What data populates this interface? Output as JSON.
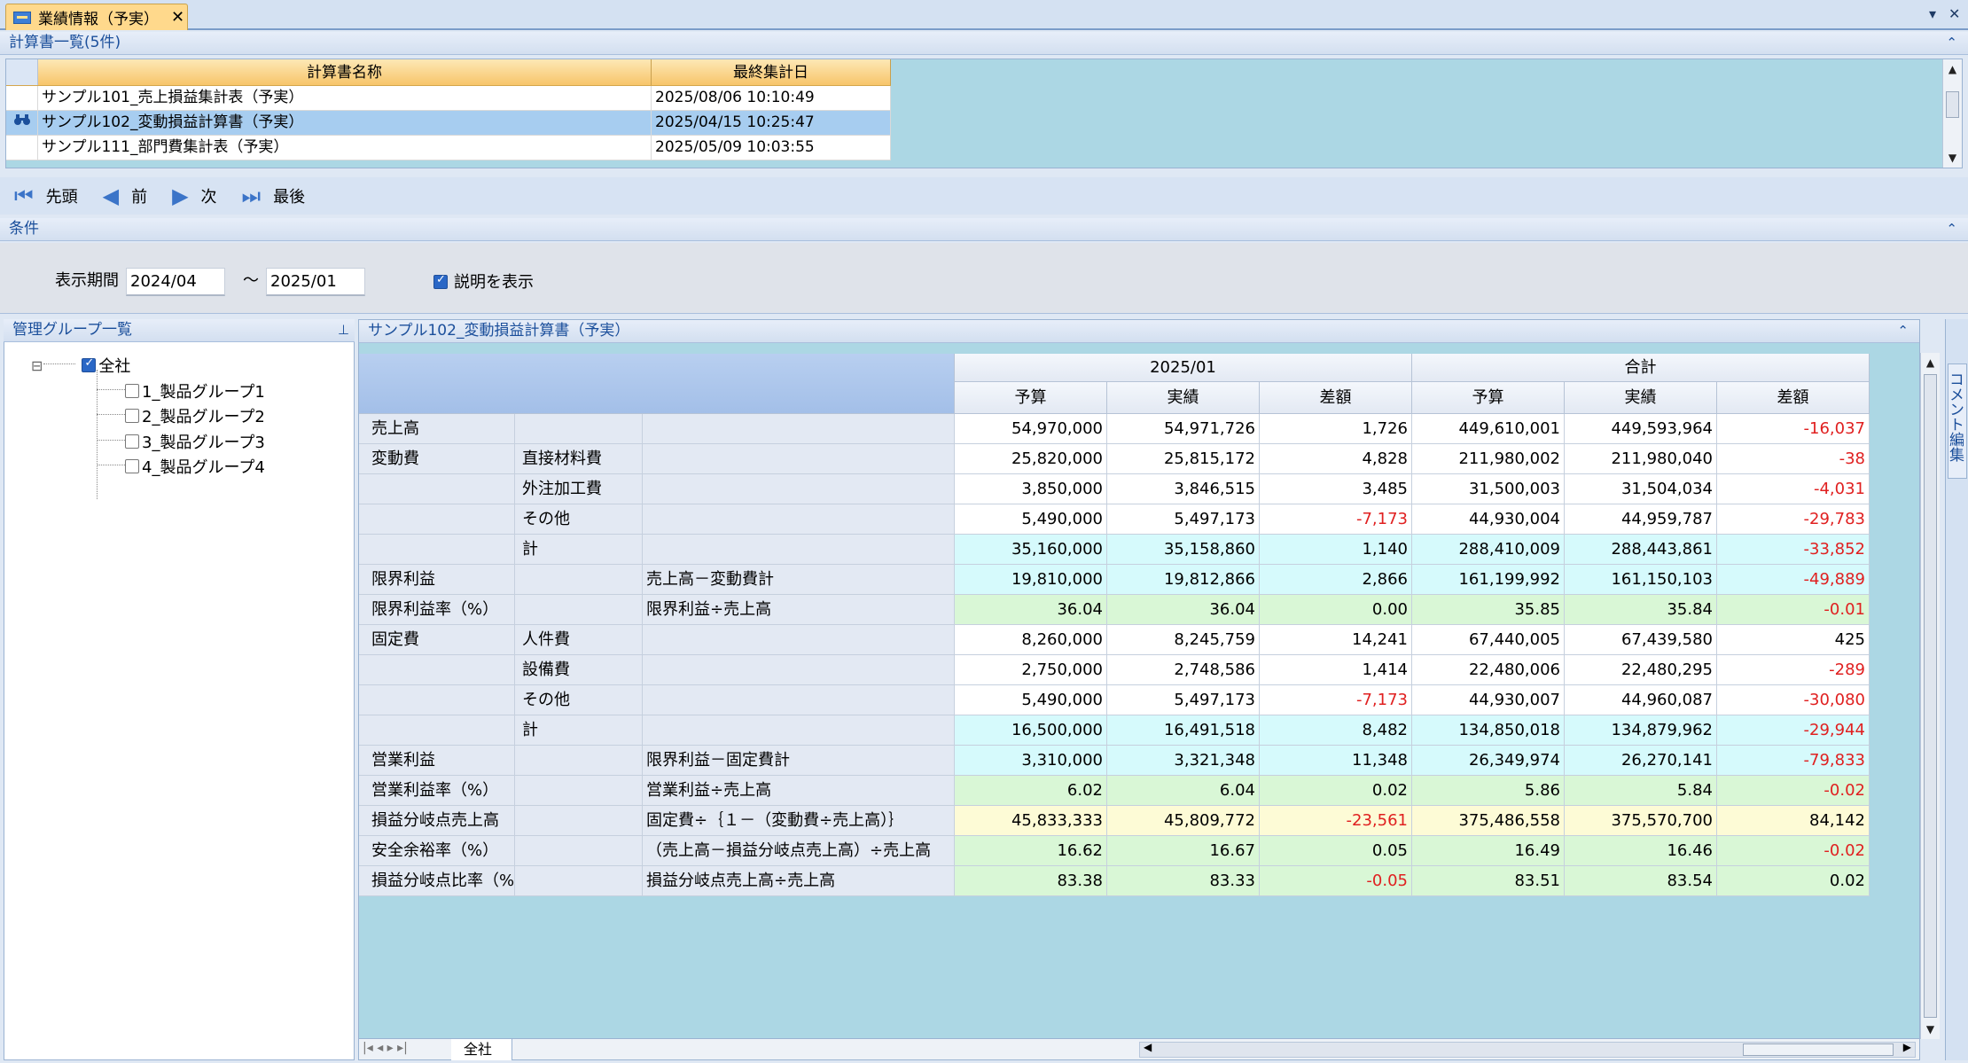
{
  "document_tab": {
    "title": "業績情報（予実）",
    "close": "✕"
  },
  "window_controls": {
    "dropdown": "▾",
    "close": "✕"
  },
  "list_panel": {
    "title": "計算書一覧(5件)",
    "columns": [
      "計算書名称",
      "最終集計日"
    ],
    "rows": [
      {
        "name": "サンプル101_売上損益集計表（予実）",
        "date": "2025/08/06 10:10:49"
      },
      {
        "name": "サンプル102_変動損益計算書（予実）",
        "date": "2025/04/15 10:25:47"
      },
      {
        "name": "サンプル111_部門費集計表（予実）",
        "date": "2025/05/09 10:03:55"
      }
    ]
  },
  "navigator": {
    "first": "先頭",
    "prev": "前",
    "next": "次",
    "last": "最後"
  },
  "condition_panel": {
    "title": "条件",
    "period_label": "表示期間",
    "period_from": "2024/04",
    "tilde": "～",
    "period_to": "2025/01",
    "show_description_label": "説明を表示",
    "show_description_checked": true
  },
  "tree_panel": {
    "title": "管理グループ一覧",
    "pin": "ᵖ",
    "root": {
      "label": "全社",
      "checked": true,
      "expander": "⊟"
    },
    "children": [
      "1_製品グループ1",
      "2_製品グループ2",
      "3_製品グループ3",
      "4_製品グループ4"
    ]
  },
  "report_panel": {
    "title": "サンプル102_変動損益計算書（予実）",
    "groups": [
      "2025/01",
      "合計"
    ],
    "subcols": [
      "予算",
      "実績",
      "差額",
      "予算",
      "実績",
      "差額"
    ],
    "rows": [
      {
        "c1": "売上高",
        "c2": "",
        "c3": "",
        "vals": [
          "54,970,000",
          "54,971,726",
          "1,726",
          "449,610,001",
          "449,593,964",
          "-16,037"
        ]
      },
      {
        "c1": "変動費",
        "c2": "直接材料費",
        "c3": "",
        "vals": [
          "25,820,000",
          "25,815,172",
          "4,828",
          "211,980,002",
          "211,980,040",
          "-38"
        ]
      },
      {
        "c1": "",
        "c2": "外注加工費",
        "c3": "",
        "vals": [
          "3,850,000",
          "3,846,515",
          "3,485",
          "31,500,003",
          "31,504,034",
          "-4,031"
        ]
      },
      {
        "c1": "",
        "c2": "その他",
        "c3": "",
        "vals": [
          "5,490,000",
          "5,497,173",
          "-7,173",
          "44,930,004",
          "44,959,787",
          "-29,783"
        ]
      },
      {
        "c1": "",
        "c2": "計",
        "c3": "",
        "vals": [
          "35,160,000",
          "35,158,860",
          "1,140",
          "288,410,009",
          "288,443,861",
          "-33,852"
        ]
      },
      {
        "c1": "限界利益",
        "c2": "",
        "c3": "売上高－変動費計",
        "vals": [
          "19,810,000",
          "19,812,866",
          "2,866",
          "161,199,992",
          "161,150,103",
          "-49,889"
        ]
      },
      {
        "c1": "限界利益率（%）",
        "c2": "",
        "c3": "限界利益÷売上高",
        "vals": [
          "36.04",
          "36.04",
          "0.00",
          "35.85",
          "35.84",
          "-0.01"
        ]
      },
      {
        "c1": "固定費",
        "c2": "人件費",
        "c3": "",
        "vals": [
          "8,260,000",
          "8,245,759",
          "14,241",
          "67,440,005",
          "67,439,580",
          "425"
        ]
      },
      {
        "c1": "",
        "c2": "設備費",
        "c3": "",
        "vals": [
          "2,750,000",
          "2,748,586",
          "1,414",
          "22,480,006",
          "22,480,295",
          "-289"
        ]
      },
      {
        "c1": "",
        "c2": "その他",
        "c3": "",
        "vals": [
          "5,490,000",
          "5,497,173",
          "-7,173",
          "44,930,007",
          "44,960,087",
          "-30,080"
        ]
      },
      {
        "c1": "",
        "c2": "計",
        "c3": "",
        "vals": [
          "16,500,000",
          "16,491,518",
          "8,482",
          "134,850,018",
          "134,879,962",
          "-29,944"
        ]
      },
      {
        "c1": "営業利益",
        "c2": "",
        "c3": "限界利益－固定費計",
        "vals": [
          "3,310,000",
          "3,321,348",
          "11,348",
          "26,349,974",
          "26,270,141",
          "-79,833"
        ]
      },
      {
        "c1": "営業利益率（%）",
        "c2": "",
        "c3": "営業利益÷売上高",
        "vals": [
          "6.02",
          "6.04",
          "0.02",
          "5.86",
          "5.84",
          "-0.02"
        ]
      },
      {
        "c1": "損益分岐点売上高",
        "c2": "",
        "c3": "固定費÷｛１－（変動費÷売上高）｝",
        "vals": [
          "45,833,333",
          "45,809,772",
          "-23,561",
          "375,486,558",
          "375,570,700",
          "84,142"
        ]
      },
      {
        "c1": "安全余裕率（%）",
        "c2": "",
        "c3": "（売上高－損益分岐点売上高）÷売上高",
        "vals": [
          "16.62",
          "16.67",
          "0.05",
          "16.49",
          "16.46",
          "-0.02"
        ]
      },
      {
        "c1": "損益分岐点比率（%）",
        "c2": "",
        "c3": "損益分岐点売上高÷売上高",
        "vals": [
          "83.38",
          "83.33",
          "-0.05",
          "83.51",
          "83.54",
          "0.02"
        ]
      }
    ],
    "row_colors": [
      "#ffffff",
      "#ffffff",
      "#ffffff",
      "#ffffff",
      "#d6fafc",
      "#d6fafc",
      "#d9f7d6",
      "#ffffff",
      "#ffffff",
      "#ffffff",
      "#d6fafc",
      "#d6fafc",
      "#d9f7d6",
      "#fdfbd6",
      "#d9f7d6",
      "#d9f7d6"
    ],
    "sheet_tab": "全社"
  },
  "comment_sidebar": {
    "label": "コメント編集"
  }
}
